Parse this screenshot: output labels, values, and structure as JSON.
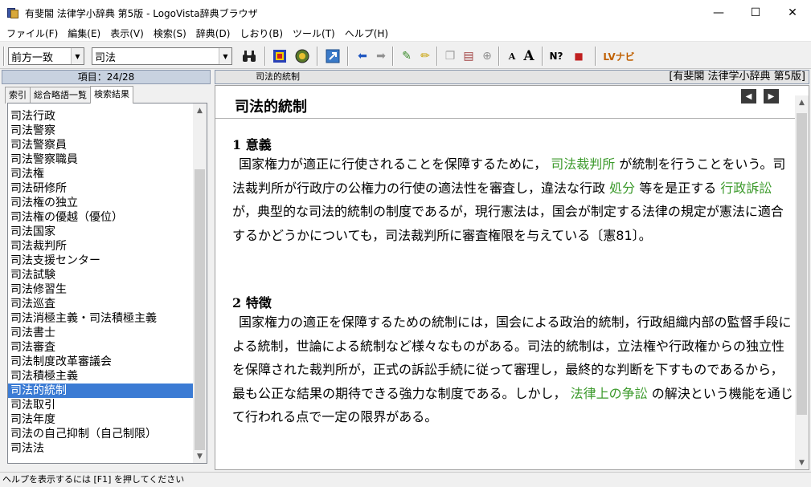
{
  "window": {
    "title": "有斐閣 法律学小辞典 第5版 - LogoVista辞典ブラウザ",
    "min_label": "—",
    "max_label": "☐",
    "close_label": "✕"
  },
  "menu": [
    "ファイル(F)",
    "編集(E)",
    "表示(V)",
    "検索(S)",
    "辞典(D)",
    "しおり(B)",
    "ツール(T)",
    "ヘルプ(H)"
  ],
  "toolbar": {
    "search_mode": "前方一致",
    "search_query": "司法",
    "font_small": "A",
    "font_large": "A",
    "help": "N?",
    "lv_navi": "LVナビ"
  },
  "left_panel": {
    "header": "項目：24/28",
    "tabs": [
      "索引",
      "総合略語一覧",
      "検索結果"
    ],
    "active_tab": 2,
    "items": [
      "司法行政",
      "司法警察",
      "司法警察員",
      "司法警察職員",
      "司法権",
      "司法研修所",
      "司法権の独立",
      "司法権の優越（優位）",
      "司法国家",
      "司法裁判所",
      "司法支援センター",
      "司法試験",
      "司法修習生",
      "司法巡査",
      "司法消極主義・司法積極主義",
      "司法書士",
      "司法審査",
      "司法制度改革審議会",
      "司法積極主義",
      "司法的統制",
      "司法取引",
      "司法年度",
      "司法の自己抑制（自己制限）",
      "司法法"
    ],
    "selected_index": 19
  },
  "right_panel": {
    "breadcrumb": "司法的統制",
    "dictionary": "[有斐閣 法律学小辞典 第5版]",
    "entry_title": "司法的統制",
    "sections": [
      {
        "heading": "1 意義",
        "segments": [
          {
            "t": "国家権力が適正に行使されることを保障するために，",
            "link": false
          },
          {
            "t": "司法裁判所",
            "link": true
          },
          {
            "t": "が統制を行うことをいう。司法裁判所が行政庁の公権力の行使の適法性を審査し，違法な行政",
            "link": false
          },
          {
            "t": "処分",
            "link": true
          },
          {
            "t": "等を是正する",
            "link": false
          },
          {
            "t": "行政訴訟",
            "link": true
          },
          {
            "t": "が，典型的な司法的統制の制度であるが，現行憲法は，国会が制定する法律の規定が憲法に適合するかどうかについても，司法裁判所に審査権限を与えている〔憲81〕。",
            "link": false
          }
        ]
      },
      {
        "heading": "2 特徴",
        "segments": [
          {
            "t": "国家権力の適正を保障するための統制には，国会による政治的統制，行政組織内部の監督手段による統制，世論による統制など様々なものがある。司法的統制は，立法権や行政権からの独立性を保障された裁判所が，正式の訴訟手続に従って審理し，最終的な判断を下すものであるから，最も公正な結果の期待できる強力な制度である。しかし，",
            "link": false
          },
          {
            "t": "法律上の争訟",
            "link": true
          },
          {
            "t": "の解決という機能を通じて行われる点で一定の限界がある。",
            "link": false
          }
        ]
      }
    ]
  },
  "status": "ヘルプを表示するには [F1] を押してください",
  "colors": {
    "link": "#3c9a2c",
    "selection": "#3b7bd4"
  },
  "icons": [
    "binoculars-icon",
    "dictionary-select-icon",
    "globe-icon",
    "jump-icon",
    "back-arrow-icon",
    "forward-arrow-icon",
    "pen-icon",
    "marker-icon",
    "copy-icon",
    "print-icon",
    "zoom-icon",
    "bookmark-icon"
  ]
}
